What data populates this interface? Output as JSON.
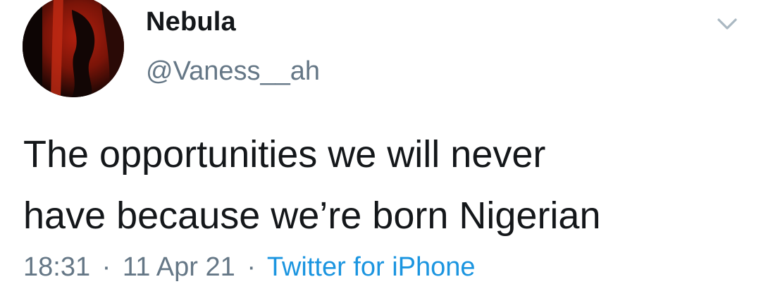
{
  "author": {
    "display_name": "Nebula",
    "handle": "@Vaness__ah"
  },
  "tweet": {
    "text_line_1": "The opportunities we will never",
    "text_line_2": "have because we’re born Nigerian"
  },
  "meta": {
    "time": "18:31",
    "separator": "·",
    "date": "11 Apr 21",
    "source": "Twitter for iPhone"
  },
  "icons": {
    "more": "chevron-down-icon"
  },
  "colors": {
    "primary_text": "#14171a",
    "secondary_text": "#657786",
    "link": "#1b95e0",
    "caret": "#aab8c2"
  }
}
